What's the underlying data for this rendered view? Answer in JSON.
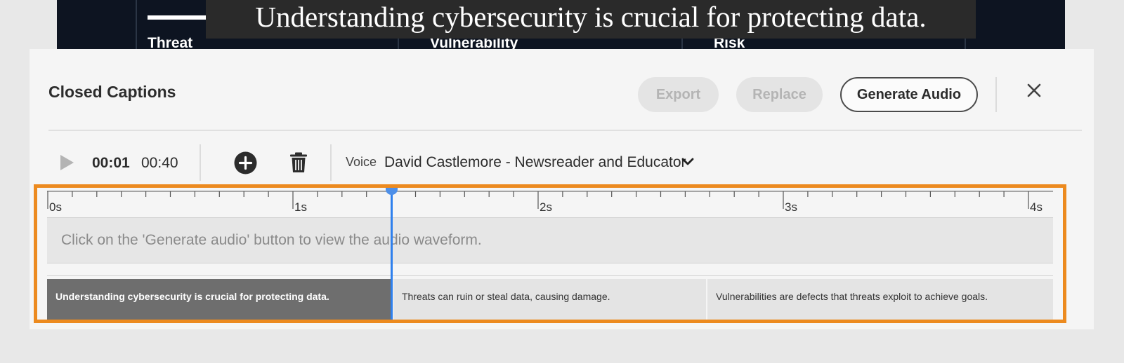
{
  "video": {
    "caption_overlay": "Understanding cybersecurity is crucial for protecting data.",
    "table_headers": [
      "Threat",
      "Vulnerability",
      "Risk"
    ]
  },
  "panel": {
    "title": "Closed Captions",
    "buttons": {
      "export": "Export",
      "replace": "Replace",
      "generate_audio": "Generate Audio"
    },
    "close_icon": "close-icon"
  },
  "toolbar": {
    "play_icon": "play-icon",
    "current_time": "00:01",
    "duration": "00:40",
    "add_icon": "add-circle-icon",
    "delete_icon": "trash-icon",
    "voice_label": "Voice",
    "voice_selected": "David Castlemore - Newsreader and Educator"
  },
  "timeline": {
    "ruler_labels": [
      "0s",
      "1s",
      "2s",
      "3s",
      "4s"
    ],
    "waveform_placeholder": "Click on the 'Generate audio' button to view the audio waveform.",
    "playhead_seconds": 1.4,
    "segments": [
      {
        "text": "Understanding cybersecurity is crucial for protecting data.",
        "active": true
      },
      {
        "text": "Threats can ruin or steal data, causing damage.",
        "active": false
      },
      {
        "text": "Vulnerabilities are defects that threats exploit to achieve goals.",
        "active": false
      }
    ]
  },
  "colors": {
    "highlight_border": "#ec8a1f",
    "playhead": "#2f80ed",
    "active_segment": "#6e6e6e"
  }
}
